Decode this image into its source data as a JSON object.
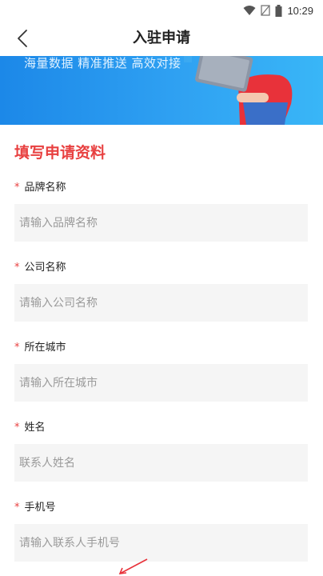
{
  "status_bar": {
    "time": "10:29"
  },
  "nav": {
    "title": "入驻申请"
  },
  "banner": {
    "slogan": "海量数据 精准推送 高效对接"
  },
  "form": {
    "section_title": "填写申请资料",
    "fields": [
      {
        "label": "品牌名称",
        "placeholder": "请输入品牌名称",
        "required": true
      },
      {
        "label": "公司名称",
        "placeholder": "请输入公司名称",
        "required": true
      },
      {
        "label": "所在城市",
        "placeholder": "请输入所在城市",
        "required": true
      },
      {
        "label": "姓名",
        "placeholder": "联系人姓名",
        "required": true
      },
      {
        "label": "手机号",
        "placeholder": "请输入联系人手机号",
        "required": true
      }
    ],
    "required_mark": "*"
  },
  "colors": {
    "accent": "#e84040",
    "banner_start": "#1c88e8",
    "banner_end": "#39b6f7",
    "input_bg": "#f5f5f5"
  }
}
